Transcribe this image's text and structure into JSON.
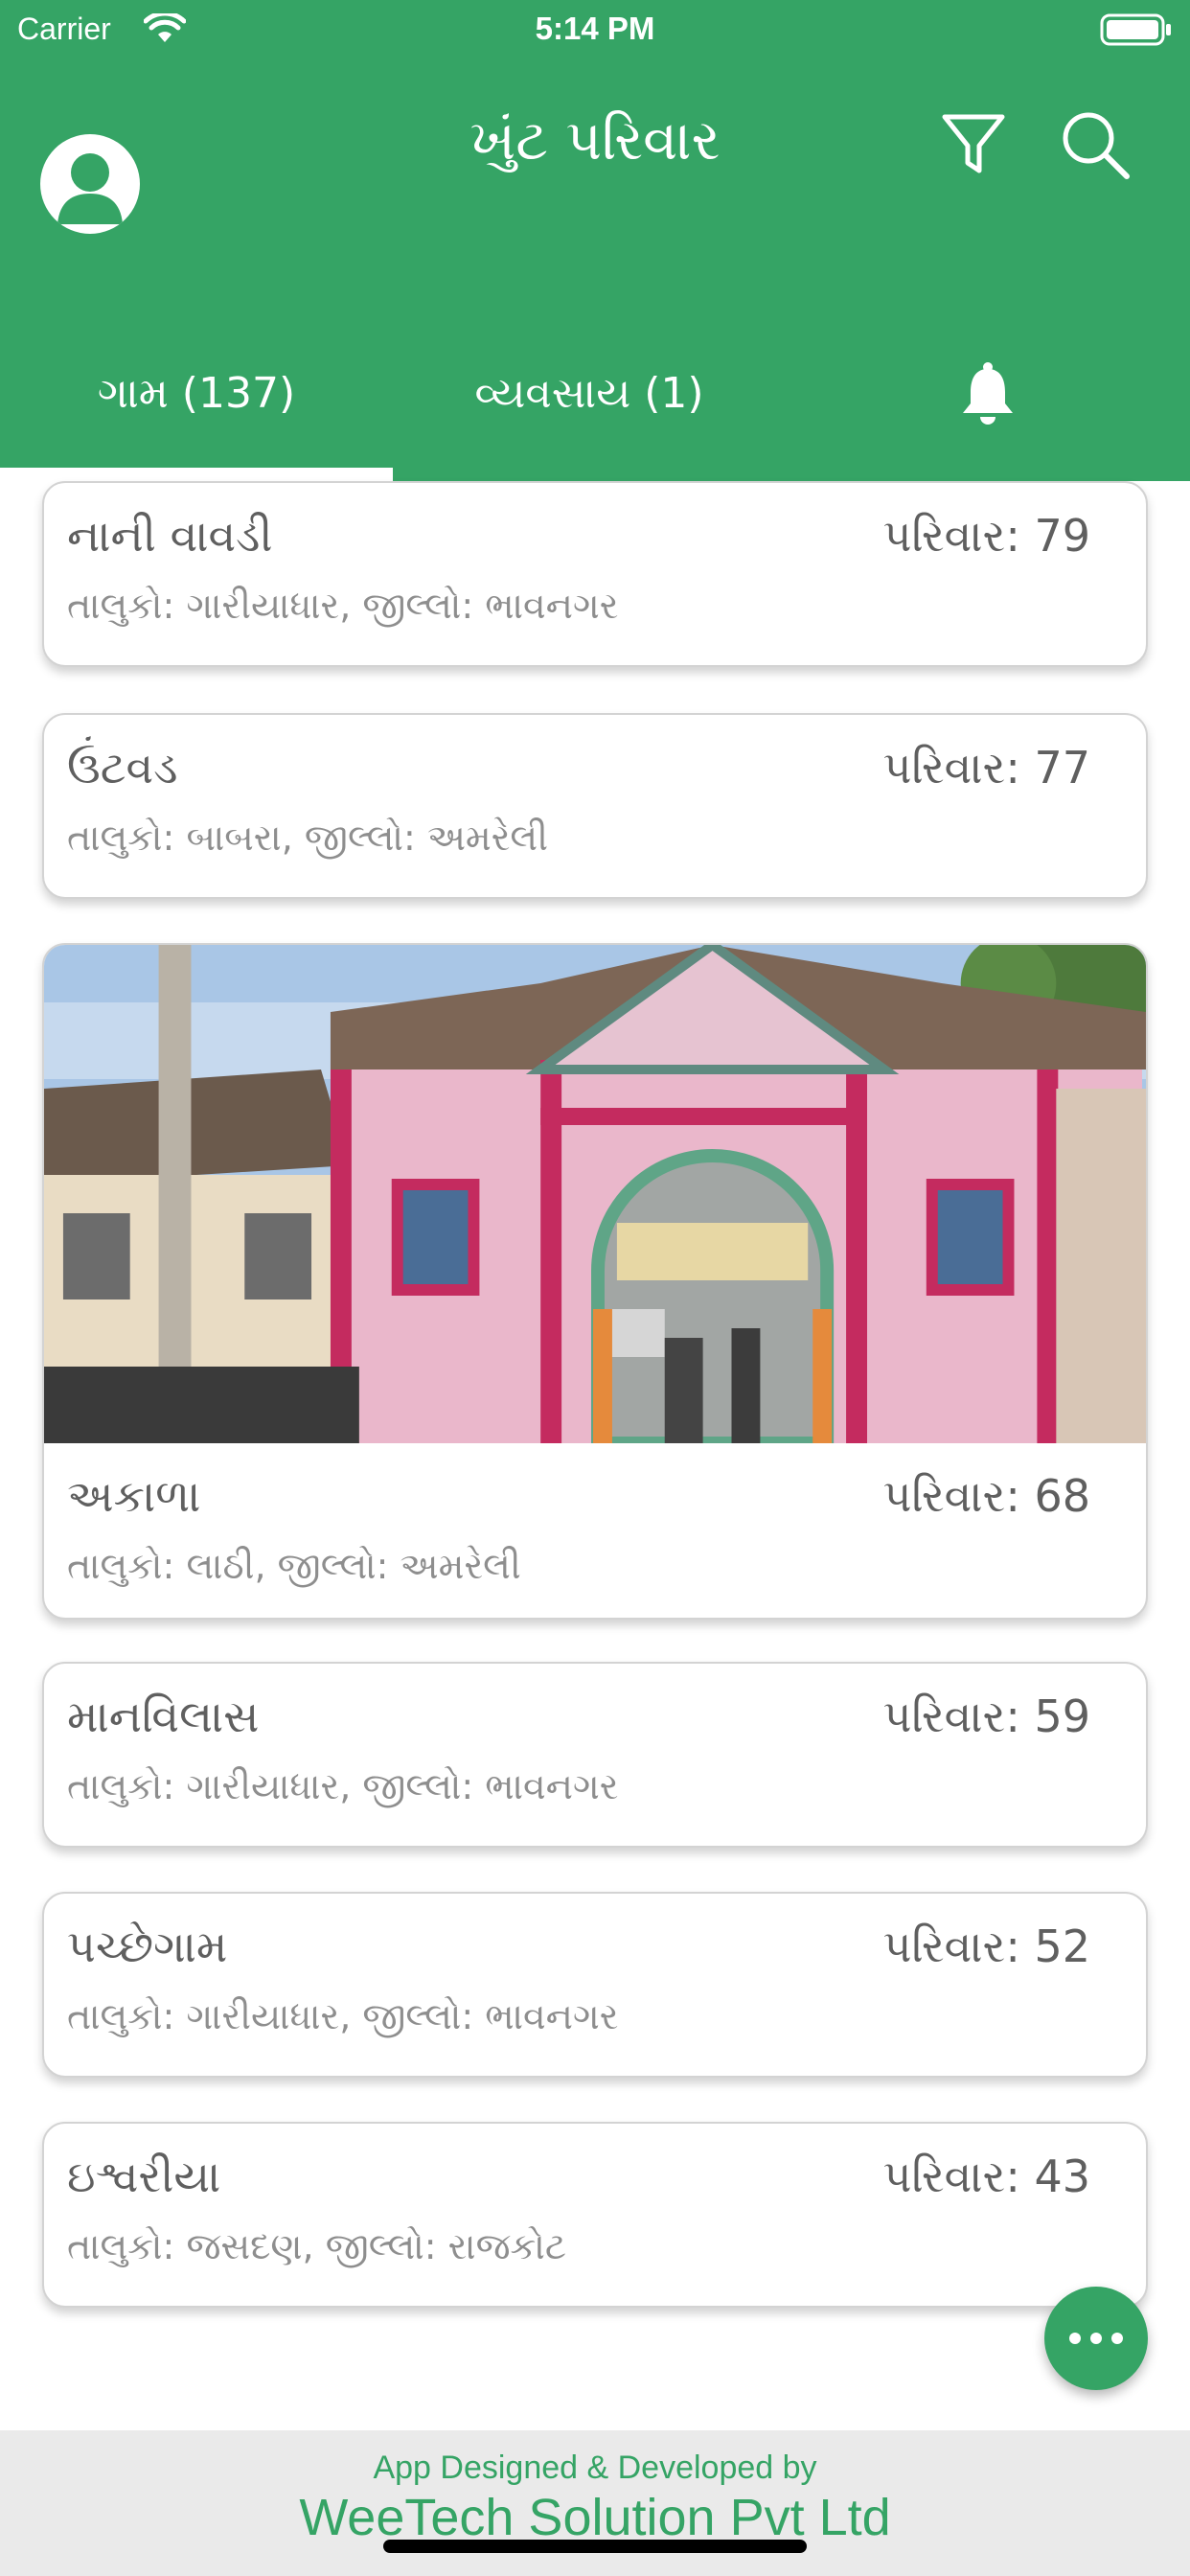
{
  "status_bar": {
    "carrier": "Carrier",
    "time": "5:14 PM"
  },
  "header": {
    "title": "ખુંટ પરિવાર"
  },
  "tabs": [
    {
      "label": "ગામ (137)",
      "selected": true
    },
    {
      "label": "વ્યવસાય (1)",
      "selected": false
    },
    {
      "icon": "bell-icon",
      "selected": false
    }
  ],
  "villages": [
    {
      "name": "નાની વાવડી",
      "families": "પરિવાર: 79",
      "location": "તાલુકો: ગારીયાધાર, જીલ્લો: ભાવનગર",
      "has_photo": false
    },
    {
      "name": "ઉંટવડ",
      "families": "પરિવાર: 77",
      "location": "તાલુકો: બાબરા, જીલ્લો: અમરેલી",
      "has_photo": false
    },
    {
      "name": "અકાળા",
      "families": "પરિવાર: 68",
      "location": "તાલુકો: લાઠી, જીલ્લો: અમરેલી",
      "has_photo": true
    },
    {
      "name": "માનવિલાસ",
      "families": "પરિવાર: 59",
      "location": "તાલુકો: ગારીયાધાર, જીલ્લો: ભાવનગર",
      "has_photo": false
    },
    {
      "name": "પચ્છેગામ",
      "families": "પરિવાર: 52",
      "location": "તાલુકો: ગારીયાધાર, જીલ્લો: ભાવનગર",
      "has_photo": false
    },
    {
      "name": "ઇશ્વરીયા",
      "families": "પરિવાર: 43",
      "location": "તાલુકો: જસદણ, જીલ્લો: રાજકોટ",
      "has_photo": false
    }
  ],
  "footer": {
    "line1": "App Designed & Developed by",
    "line2": "WeeTech Solution Pvt Ltd"
  },
  "colors": {
    "brand_green": "#35a465",
    "card_text": "#5f5f5f",
    "card_subtext": "#8e8e8e",
    "footer_bg": "#eaeaea"
  },
  "icons": [
    "wifi-icon",
    "battery-icon",
    "avatar-icon",
    "filter-icon",
    "search-icon",
    "bell-icon",
    "more-icon"
  ]
}
